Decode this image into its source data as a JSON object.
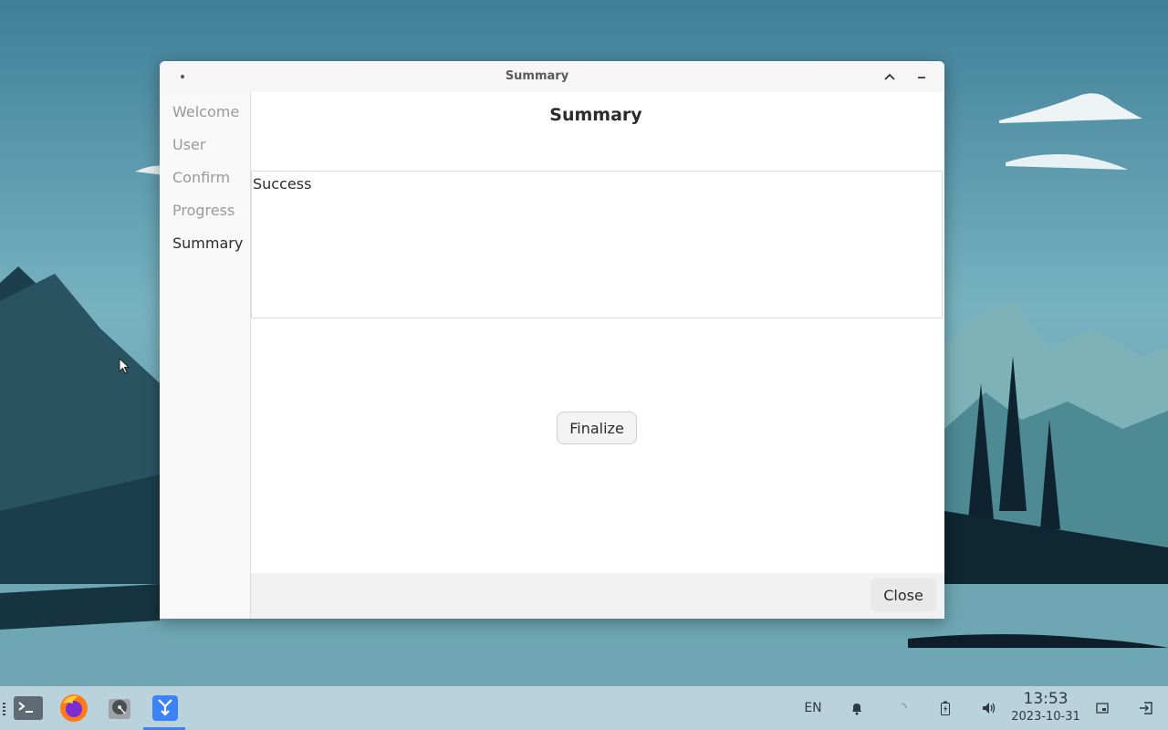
{
  "window": {
    "title": "Summary"
  },
  "sidebar": {
    "items": [
      {
        "label": "Welcome"
      },
      {
        "label": "User"
      },
      {
        "label": "Confirm"
      },
      {
        "label": "Progress"
      },
      {
        "label": "Summary",
        "active": true
      }
    ]
  },
  "main": {
    "heading": "Summary",
    "log_text": "Success",
    "finalize_label": "Finalize",
    "close_label": "Close"
  },
  "taskbar": {
    "apps": [
      {
        "icon": "terminal-icon"
      },
      {
        "icon": "firefox-icon"
      },
      {
        "icon": "disk-utility-icon"
      },
      {
        "icon": "installer-icon",
        "active": true
      }
    ],
    "language": "EN",
    "time": "13:53",
    "date": "2023-10-31",
    "accent_color": "#3b82f6"
  }
}
